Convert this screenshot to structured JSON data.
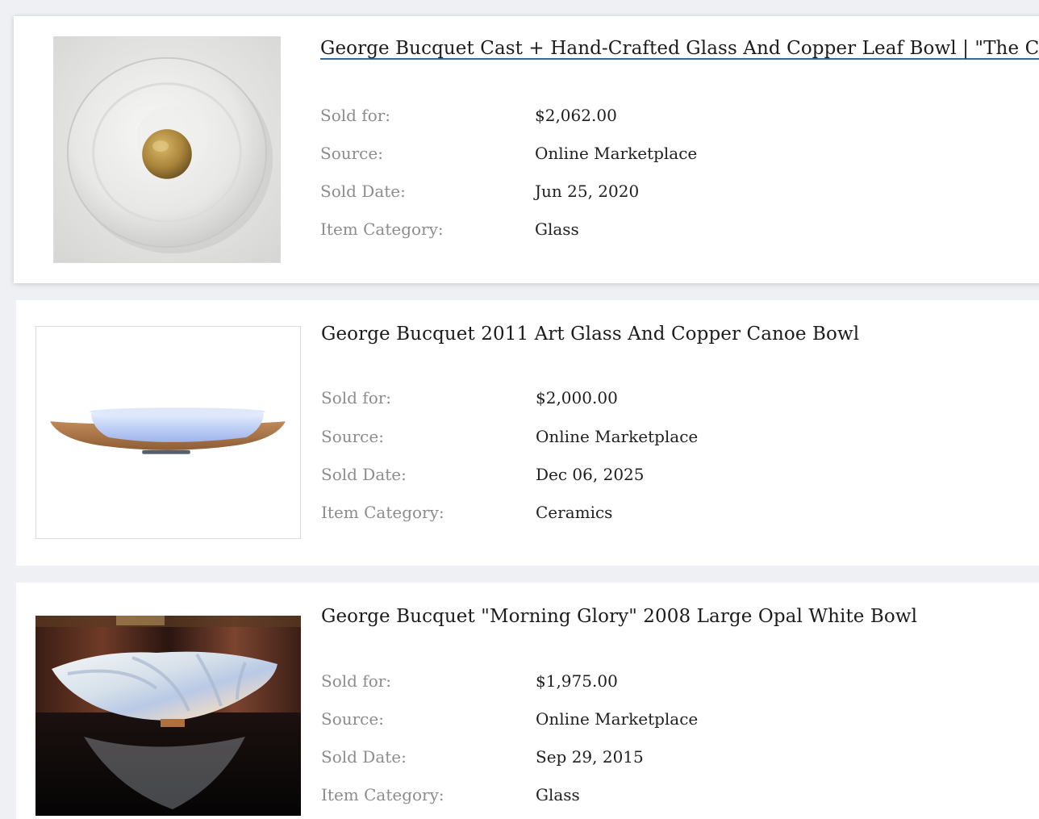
{
  "listings": [
    {
      "title": "George Bucquet Cast + Hand-Crafted Glass And Copper Leaf Bowl | \"The Circle\"",
      "image_alt": "white glass circle bowl with copper leaf center",
      "fields": [
        {
          "label": "Sold for:",
          "value": "$2,062.00"
        },
        {
          "label": "Source:",
          "value": "Online Marketplace"
        },
        {
          "label": "Sold Date:",
          "value": "Jun 25, 2020"
        },
        {
          "label": "Item Category:",
          "value": "Glass"
        }
      ]
    },
    {
      "title": "George Bucquet 2011 Art Glass And Copper Canoe Bowl",
      "image_alt": "pale blue glass bowl on copper canoe base",
      "fields": [
        {
          "label": "Sold for:",
          "value": "$2,000.00"
        },
        {
          "label": "Source:",
          "value": "Online Marketplace"
        },
        {
          "label": "Sold Date:",
          "value": "Dec 06, 2025"
        },
        {
          "label": "Item Category:",
          "value": "Ceramics"
        }
      ]
    },
    {
      "title": "George Bucquet \"Morning Glory\" 2008 Large Opal White Bowl",
      "image_alt": "opal white swirled bowl on dark table",
      "fields": [
        {
          "label": "Sold for:",
          "value": "$1,975.00"
        },
        {
          "label": "Source:",
          "value": "Online Marketplace"
        },
        {
          "label": "Sold Date:",
          "value": "Sep 29, 2015"
        },
        {
          "label": "Item Category:",
          "value": "Glass"
        }
      ]
    }
  ],
  "colors": {
    "page_background": "#eef0f3",
    "card_background": "#ffffff",
    "label_text": "#8c8c8c",
    "value_text": "#1f1f1f",
    "link_underline": "#2f6f96"
  }
}
